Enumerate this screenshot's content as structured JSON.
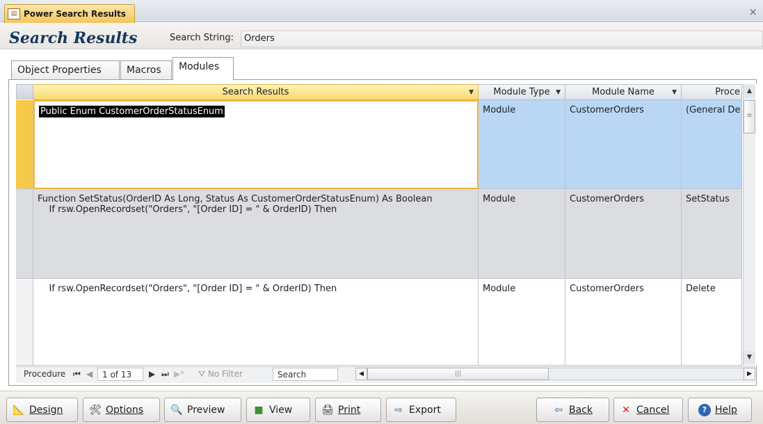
{
  "document_tab": {
    "title": "Power Search Results",
    "close_glyph": "×"
  },
  "header": {
    "title": "Search Results",
    "search_string_label": "Search String:",
    "search_string_value": "Orders"
  },
  "tabs": [
    {
      "label": "Object Properties"
    },
    {
      "label": "Macros"
    },
    {
      "label": "Modules"
    }
  ],
  "grid": {
    "columns": [
      "Search Results",
      "Module Type",
      "Module Name",
      "Proce"
    ],
    "rows": [
      {
        "result": "Public Enum CustomerOrderStatusEnum",
        "module_type": "Module",
        "module_name": "CustomerOrders",
        "procedure": "(General De"
      },
      {
        "result": "Function SetStatus(OrderID As Long, Status As CustomerOrderStatusEnum) As Boolean\n    If rsw.OpenRecordset(\"Orders\", \"[Order ID] = \" & OrderID) Then",
        "module_type": "Module",
        "module_name": "CustomerOrders",
        "procedure": "SetStatus"
      },
      {
        "result": "    If rsw.OpenRecordset(\"Orders\", \"[Order ID] = \" & OrderID) Then",
        "module_type": "Module",
        "module_name": "CustomerOrders",
        "procedure": "Delete"
      }
    ]
  },
  "navigation": {
    "record_label": "Procedure",
    "position": "1 of 13",
    "filter_label": "No Filter",
    "search_value": "Search"
  },
  "footer": {
    "design": "Design",
    "options": "Options",
    "preview": "Preview",
    "view": "View",
    "print": "Print",
    "export": "Export",
    "back": "Back",
    "cancel": "Cancel",
    "help": "Help"
  },
  "colors": {
    "doc_tab": "#f3c65c",
    "title": "#17375e",
    "active_row_selector": "#f7c948",
    "selected_cells": "#b9d7f5",
    "cancel_icon": "#d42020"
  },
  "icons": [
    "form-icon",
    "design-icon",
    "options-icon",
    "preview-icon",
    "view-icon",
    "print-icon",
    "export-icon",
    "back-arrow-icon",
    "cancel-x-icon",
    "help-icon"
  ]
}
